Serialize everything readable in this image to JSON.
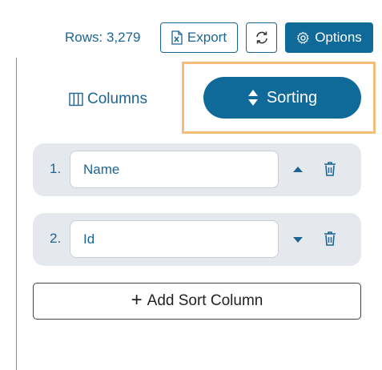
{
  "toolbar": {
    "rows_label": "Rows: 3,279",
    "export_label": "Export",
    "options_label": "Options"
  },
  "tabs": {
    "columns_label": "Columns",
    "sorting_label": "Sorting",
    "active": "Sorting"
  },
  "sort_columns": [
    {
      "index": "1.",
      "field": "Name",
      "direction": "ascending"
    },
    {
      "index": "2.",
      "field": "Id",
      "direction": "descending"
    }
  ],
  "add_sort_label": "Add Sort Column",
  "icons": {
    "export": "excel-file-icon",
    "refresh": "refresh-icon",
    "options": "gear-icon",
    "columns": "columns-icon",
    "sorting": "sort-icon",
    "ascending": "caret-up-icon",
    "descending": "caret-down-icon",
    "delete": "trash-icon",
    "add": "plus-icon"
  },
  "colors": {
    "accent": "#0f6a9a",
    "text_accent": "#1c6593",
    "highlight": "#f5bd7a",
    "row_bg": "#e5e9ee"
  }
}
